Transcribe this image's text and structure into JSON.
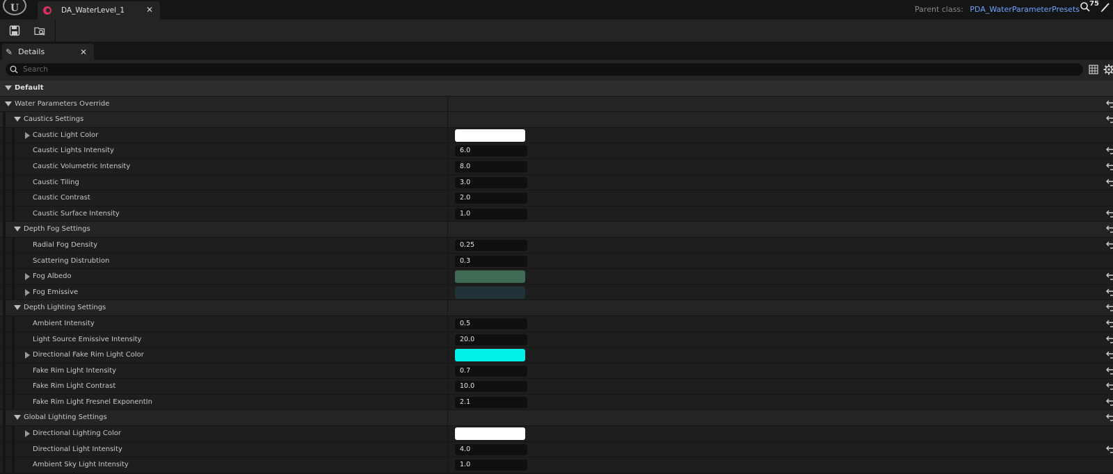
{
  "titlebar": {
    "asset_tab_label": "DA_WaterLevel_1",
    "parent_class_label": "Parent class:",
    "parent_class_value": "PDA_WaterParameterPresets",
    "counter": "75"
  },
  "details_tab": {
    "label": "Details"
  },
  "search": {
    "placeholder": "Search"
  },
  "colors": {
    "accent": "#6fa4ff",
    "tab_icon": "#d6305f"
  },
  "rows": [
    {
      "kind": "cat",
      "level": 0,
      "expand": "down",
      "label": "Default",
      "name": "category-default"
    },
    {
      "kind": "sub",
      "level": 0,
      "expand": "down",
      "label": "Water Parameters Override",
      "reset": true,
      "name": "group-water-parameters-override"
    },
    {
      "kind": "sub",
      "level": 1,
      "expand": "down",
      "label": "Caustics Settings",
      "reset": true,
      "name": "group-caustics-settings"
    },
    {
      "kind": "prop",
      "level": 2,
      "expand": "right",
      "label": "Caustic Light Color",
      "color": "#ffffff",
      "name": "prop-caustic-light-color"
    },
    {
      "kind": "prop",
      "level": 2,
      "label": "Caustic Lights Intensity",
      "value": "6.0",
      "reset": true,
      "name": "prop-caustic-lights-intensity"
    },
    {
      "kind": "prop",
      "level": 2,
      "label": "Caustic Volumetric Intensity",
      "value": "8.0",
      "reset": true,
      "name": "prop-caustic-volumetric-intensity"
    },
    {
      "kind": "prop",
      "level": 2,
      "label": "Caustic Tiling",
      "value": "3.0",
      "reset": true,
      "name": "prop-caustic-tiling"
    },
    {
      "kind": "prop",
      "level": 2,
      "label": "Caustic Contrast",
      "value": "2.0",
      "name": "prop-caustic-contrast"
    },
    {
      "kind": "prop",
      "level": 2,
      "label": "Caustic Surface Intensity",
      "value": "1.0",
      "reset": true,
      "name": "prop-caustic-surface-intensity"
    },
    {
      "kind": "sub",
      "level": 1,
      "expand": "down",
      "label": "Depth Fog Settings",
      "reset": true,
      "name": "group-depth-fog-settings"
    },
    {
      "kind": "prop",
      "level": 2,
      "label": "Radial Fog Density",
      "value": "0.25",
      "reset": true,
      "name": "prop-radial-fog-density"
    },
    {
      "kind": "prop",
      "level": 2,
      "label": "Scattering Distrubtion",
      "value": "0.3",
      "name": "prop-scattering-distribution"
    },
    {
      "kind": "prop",
      "level": 2,
      "expand": "right",
      "label": "Fog Albedo",
      "color": "#3f6b55",
      "reset": true,
      "name": "prop-fog-albedo"
    },
    {
      "kind": "prop",
      "level": 2,
      "expand": "right",
      "label": "Fog Emissive",
      "color": "#1f3338",
      "reset": true,
      "name": "prop-fog-emissive"
    },
    {
      "kind": "sub",
      "level": 1,
      "expand": "down",
      "label": "Depth Lighting Settings",
      "reset": true,
      "name": "group-depth-lighting-settings"
    },
    {
      "kind": "prop",
      "level": 2,
      "label": "Ambient Intensity",
      "value": "0.5",
      "reset": true,
      "name": "prop-ambient-intensity"
    },
    {
      "kind": "prop",
      "level": 2,
      "label": "Light Source Emissive Intensity",
      "value": "20.0",
      "reset": true,
      "name": "prop-light-source-emissive-intensity"
    },
    {
      "kind": "prop",
      "level": 2,
      "expand": "right",
      "label": "Directional Fake Rim Light Color",
      "color": "#00f2e6",
      "reset": true,
      "name": "prop-directional-fake-rim-light-color"
    },
    {
      "kind": "prop",
      "level": 2,
      "label": "Fake Rim Light Intensity",
      "value": "0.7",
      "reset": true,
      "name": "prop-fake-rim-light-intensity"
    },
    {
      "kind": "prop",
      "level": 2,
      "label": "Fake Rim Light Contrast",
      "value": "10.0",
      "reset": true,
      "name": "prop-fake-rim-light-contrast"
    },
    {
      "kind": "prop",
      "level": 2,
      "label": "Fake Rim Light Fresnel ExponentIn",
      "value": "2.1",
      "reset": true,
      "name": "prop-fake-rim-light-fresnel-exponent"
    },
    {
      "kind": "sub",
      "level": 1,
      "expand": "down",
      "label": "Global Lighting Settings",
      "reset": true,
      "name": "group-global-lighting-settings"
    },
    {
      "kind": "prop",
      "level": 2,
      "expand": "right",
      "label": "Directional Lighting Color",
      "color": "#ffffff",
      "name": "prop-directional-lighting-color"
    },
    {
      "kind": "prop",
      "level": 2,
      "label": "Directional Light Intensity",
      "value": "4.0",
      "reset": true,
      "name": "prop-directional-light-intensity"
    },
    {
      "kind": "prop",
      "level": 2,
      "label": "Ambient Sky Light Intensity",
      "value": "1.0",
      "name": "prop-ambient-sky-light-intensity"
    }
  ]
}
